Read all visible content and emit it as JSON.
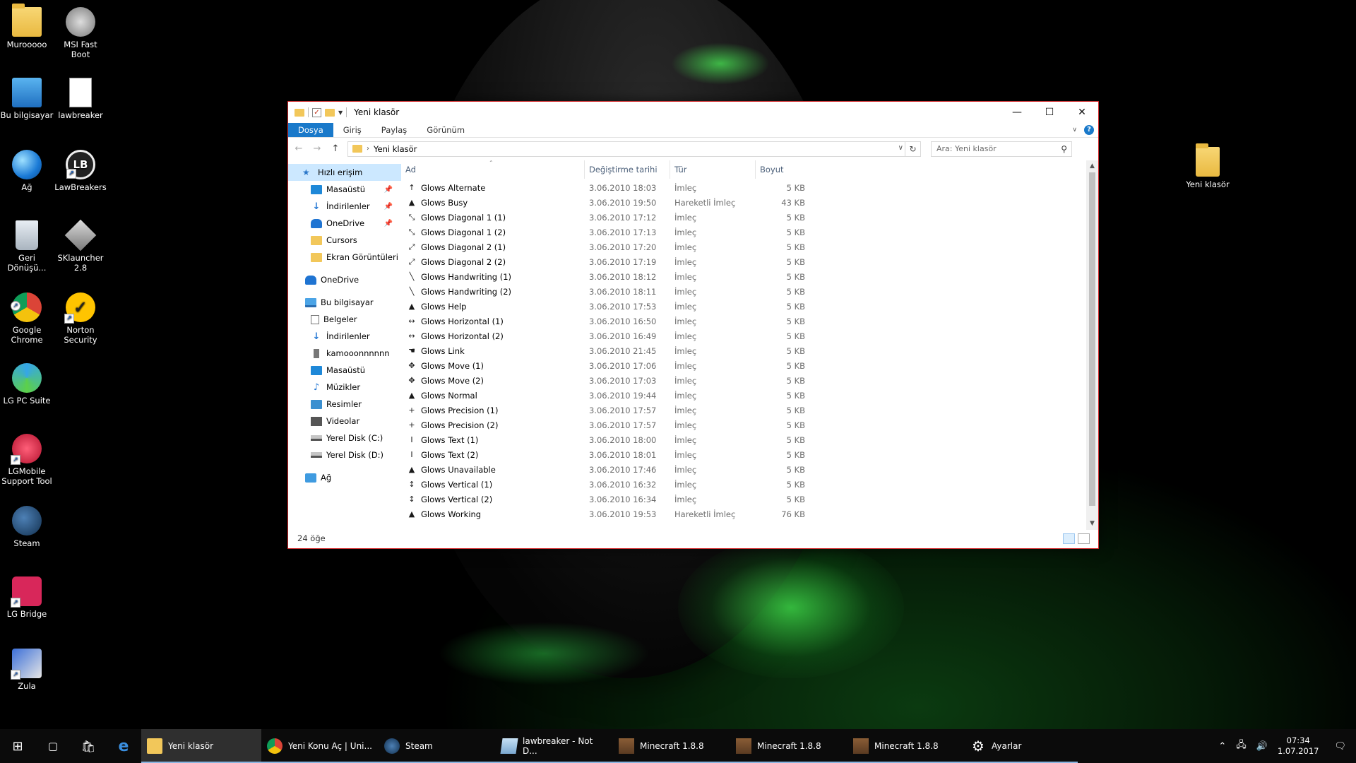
{
  "desktop": {
    "left_icons": [
      {
        "label": "Murooooo",
        "icon": "user-folder-icon"
      },
      {
        "label": "MSI Fast Boot",
        "icon": "msi-fast-boot-icon"
      },
      {
        "label": "Bu bilgisayar",
        "icon": "computer-icon"
      },
      {
        "label": "lawbreaker",
        "icon": "text-document-icon"
      },
      {
        "label": "Ağ",
        "icon": "network-icon"
      },
      {
        "label": "LawBreakers",
        "icon": "lawbreakers-icon"
      },
      {
        "label": "Geri Dönüşü...",
        "icon": "recycle-bin-icon"
      },
      {
        "label": "SKlauncher 2.8",
        "icon": "sklauncher-icon"
      },
      {
        "label": "Google Chrome",
        "icon": "chrome-icon"
      },
      {
        "label": "Norton Security",
        "icon": "norton-icon"
      },
      {
        "label": "LG PC Suite",
        "icon": "lg-pc-suite-icon"
      },
      {
        "label": "LGMobile Support Tool",
        "icon": "lgmobile-icon"
      },
      {
        "label": "Steam",
        "icon": "steam-icon"
      },
      {
        "label": "LG Bridge",
        "icon": "lg-bridge-icon"
      },
      {
        "label": "Zula",
        "icon": "zula-icon"
      }
    ],
    "right_icons": [
      {
        "label": "Yeni klasör",
        "icon": "folder-icon"
      }
    ]
  },
  "window": {
    "title": "Yeni klasör",
    "ribbon_tabs": [
      "Dosya",
      "Giriş",
      "Paylaş",
      "Görünüm"
    ],
    "address": "Yeni klasör",
    "search_placeholder": "Ara: Yeni klasör",
    "nav": {
      "quick_access": "Hızlı erişim",
      "quick_items": [
        "Masaüstü",
        "İndirilenler",
        "OneDrive",
        "Cursors",
        "Ekran Görüntüleri"
      ],
      "onedrive": "OneDrive",
      "this_pc": "Bu bilgisayar",
      "pc_items": [
        "Belgeler",
        "İndirilenler",
        "kamooonnnnnn",
        "Masaüstü",
        "Müzikler",
        "Resimler",
        "Videolar",
        "Yerel Disk (C:)",
        "Yerel Disk (D:)"
      ],
      "network": "Ağ"
    },
    "columns": {
      "name": "Ad",
      "date": "Değiştirme tarihi",
      "type": "Tür",
      "size": "Boyut"
    },
    "files": [
      {
        "name": "Glows Alternate",
        "date": "3.06.2010 18:03",
        "type": "İmleç",
        "size": "5 KB",
        "glyph": "↑"
      },
      {
        "name": "Glows Busy",
        "date": "3.06.2010 19:50",
        "type": "Hareketli İmleç",
        "size": "43 KB",
        "glyph": "▲"
      },
      {
        "name": "Glows Diagonal 1 (1)",
        "date": "3.06.2010 17:12",
        "type": "İmleç",
        "size": "5 KB",
        "glyph": "⤡"
      },
      {
        "name": "Glows Diagonal 1 (2)",
        "date": "3.06.2010 17:13",
        "type": "İmleç",
        "size": "5 KB",
        "glyph": "⤡"
      },
      {
        "name": "Glows Diagonal 2 (1)",
        "date": "3.06.2010 17:20",
        "type": "İmleç",
        "size": "5 KB",
        "glyph": "⤢"
      },
      {
        "name": "Glows Diagonal 2 (2)",
        "date": "3.06.2010 17:19",
        "type": "İmleç",
        "size": "5 KB",
        "glyph": "⤢"
      },
      {
        "name": "Glows Handwriting (1)",
        "date": "3.06.2010 18:12",
        "type": "İmleç",
        "size": "5 KB",
        "glyph": "╲"
      },
      {
        "name": "Glows Handwriting (2)",
        "date": "3.06.2010 18:11",
        "type": "İmleç",
        "size": "5 KB",
        "glyph": "╲"
      },
      {
        "name": "Glows Help",
        "date": "3.06.2010 17:53",
        "type": "İmleç",
        "size": "5 KB",
        "glyph": "▲"
      },
      {
        "name": "Glows Horizontal (1)",
        "date": "3.06.2010 16:50",
        "type": "İmleç",
        "size": "5 KB",
        "glyph": "↔"
      },
      {
        "name": "Glows Horizontal (2)",
        "date": "3.06.2010 16:49",
        "type": "İmleç",
        "size": "5 KB",
        "glyph": "↔"
      },
      {
        "name": "Glows Link",
        "date": "3.06.2010 21:45",
        "type": "İmleç",
        "size": "5 KB",
        "glyph": "☚"
      },
      {
        "name": "Glows Move (1)",
        "date": "3.06.2010 17:06",
        "type": "İmleç",
        "size": "5 KB",
        "glyph": "✥"
      },
      {
        "name": "Glows Move (2)",
        "date": "3.06.2010 17:03",
        "type": "İmleç",
        "size": "5 KB",
        "glyph": "✥"
      },
      {
        "name": "Glows Normal",
        "date": "3.06.2010 19:44",
        "type": "İmleç",
        "size": "5 KB",
        "glyph": "▲"
      },
      {
        "name": "Glows Precision (1)",
        "date": "3.06.2010 17:57",
        "type": "İmleç",
        "size": "5 KB",
        "glyph": "+"
      },
      {
        "name": "Glows Precision (2)",
        "date": "3.06.2010 17:57",
        "type": "İmleç",
        "size": "5 KB",
        "glyph": "+"
      },
      {
        "name": "Glows Text (1)",
        "date": "3.06.2010 18:00",
        "type": "İmleç",
        "size": "5 KB",
        "glyph": "I"
      },
      {
        "name": "Glows Text (2)",
        "date": "3.06.2010 18:01",
        "type": "İmleç",
        "size": "5 KB",
        "glyph": "I"
      },
      {
        "name": "Glows Unavailable",
        "date": "3.06.2010 17:46",
        "type": "İmleç",
        "size": "5 KB",
        "glyph": "▲"
      },
      {
        "name": "Glows Vertical (1)",
        "date": "3.06.2010 16:32",
        "type": "İmleç",
        "size": "5 KB",
        "glyph": "↕"
      },
      {
        "name": "Glows Vertical (2)",
        "date": "3.06.2010 16:34",
        "type": "İmleç",
        "size": "5 KB",
        "glyph": "↕"
      },
      {
        "name": "Glows Working",
        "date": "3.06.2010 19:53",
        "type": "Hareketli İmleç",
        "size": "76 KB",
        "glyph": "▲"
      }
    ],
    "status": "24 öğe"
  },
  "taskbar": {
    "apps": [
      {
        "label": "Yeni klasör",
        "icon": "folder-icon",
        "active": true
      },
      {
        "label": "Yeni Konu Aç | Uni...",
        "icon": "chrome-icon",
        "active": false
      },
      {
        "label": "Steam",
        "icon": "steam-icon",
        "active": false
      },
      {
        "label": "lawbreaker - Not D...",
        "icon": "notepad-icon",
        "active": false
      },
      {
        "label": "Minecraft 1.8.8",
        "icon": "minecraft-icon",
        "active": false
      },
      {
        "label": "Minecraft 1.8.8",
        "icon": "minecraft-icon",
        "active": false
      },
      {
        "label": "Minecraft 1.8.8",
        "icon": "minecraft-icon",
        "active": false
      },
      {
        "label": "Ayarlar",
        "icon": "gear-icon",
        "active": false
      }
    ],
    "time": "07:34",
    "date": "1.07.2017"
  },
  "colors": {
    "accent": "#1979ca",
    "window_border": "#d02628",
    "selection": "#cce8ff"
  }
}
